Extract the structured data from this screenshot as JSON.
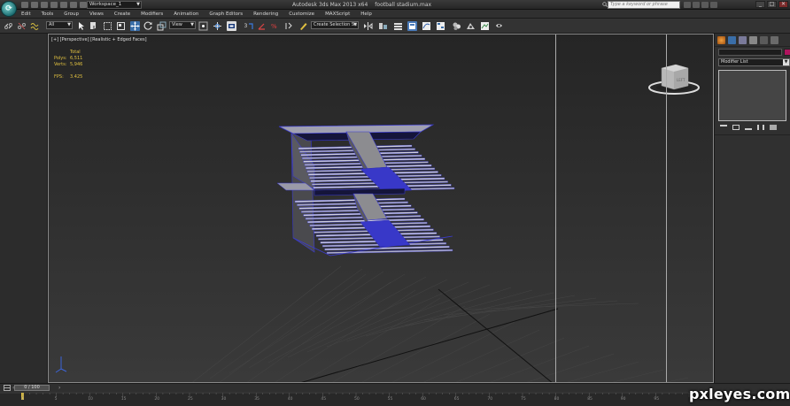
{
  "titlebar": {
    "workspace": "Workspace_1",
    "app_title": "Autodesk 3ds Max  2013 x64",
    "file_name": "football stadium.max",
    "search_placeholder": "Type a keyword or phrase",
    "min": "_",
    "max": "□",
    "close": "✕"
  },
  "menu": [
    "Edit",
    "Tools",
    "Group",
    "Views",
    "Create",
    "Modifiers",
    "Animation",
    "Graph Editors",
    "Rendering",
    "Customize",
    "MAXScript",
    "Help"
  ],
  "toolbar": {
    "selection_filter": "All",
    "reference_coord": "View",
    "named_selection": "Create Selection Se"
  },
  "viewport": {
    "label": "[+] [Perspective] [Realistic + Edged Faces]",
    "stats": {
      "total_label": "Total",
      "polys_label": "Polys:",
      "polys_value": "6,511",
      "verts_label": "Verts:",
      "verts_value": "5,946",
      "fps_label": "FPS:",
      "fps_value": "3.425"
    },
    "viewcube_label": "LEFT"
  },
  "command_panel": {
    "modifier_list": "Modifier List",
    "object_color": "#b0145e"
  },
  "timeline": {
    "frame_display": "0 / 100",
    "ticks": [
      "0",
      "5",
      "10",
      "15",
      "20",
      "25",
      "30",
      "35",
      "40",
      "45",
      "50",
      "55",
      "60",
      "65",
      "70",
      "75",
      "80",
      "85",
      "90",
      "95"
    ]
  },
  "watermark": "pxleyes.com"
}
